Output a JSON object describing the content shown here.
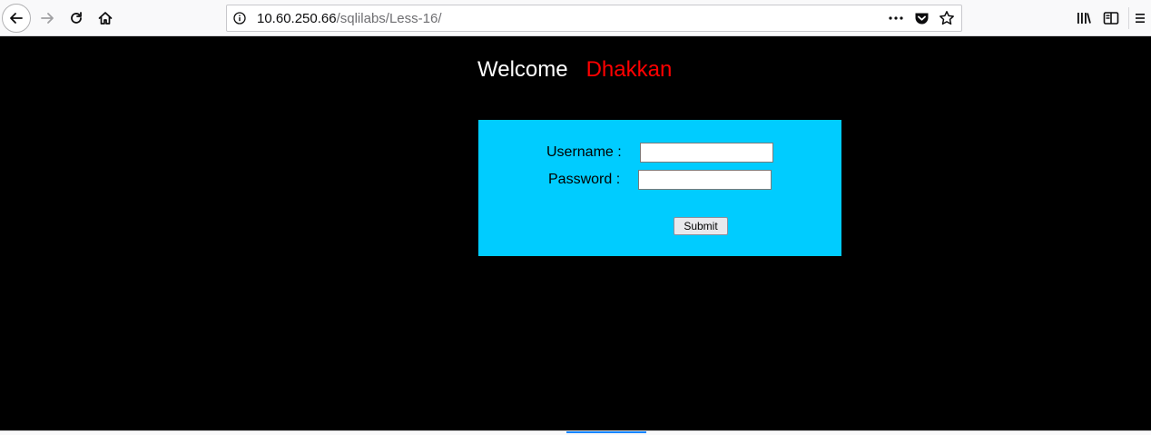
{
  "browser": {
    "url_host": "10.60.250.66",
    "url_path": "/sqlilabs/Less-16/",
    "icons": {
      "back": "back-arrow-icon",
      "forward": "forward-arrow-icon",
      "reload": "reload-icon",
      "home": "home-icon",
      "info": "info-icon",
      "page_actions": "more-dots-icon",
      "pocket": "pocket-icon",
      "bookmark": "star-icon",
      "library": "library-icon",
      "sidebar": "sidebar-icon",
      "menu": "hamburger-menu-icon"
    }
  },
  "page": {
    "welcome_text": "Welcome",
    "welcome_name": "Dhakkan",
    "colors": {
      "background": "#000000",
      "welcome_text": "#ffffff",
      "welcome_name": "#ff0000",
      "form_background": "#00ccff"
    },
    "form": {
      "username_label": "Username :",
      "username_value": "",
      "password_label": "Password :",
      "password_value": "",
      "submit_label": "Submit"
    }
  }
}
